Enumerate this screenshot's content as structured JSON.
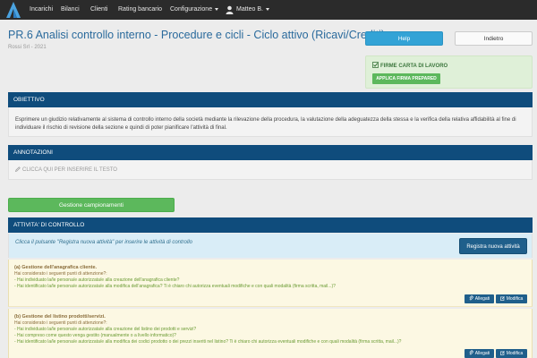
{
  "navbar": {
    "items": [
      "Incarichi",
      "Bilanci",
      "Clienti",
      "Rating bancario",
      "Configurazione"
    ],
    "user": "Matteo B."
  },
  "header": {
    "title": "PR.6 Analisi controllo interno - Procedure e cicli - Ciclo attivo (Ricavi/Crediti)",
    "subtitle": "Rossi Srl - 2021",
    "help_label": "Help",
    "back_label": "Indietro"
  },
  "firme": {
    "title": "FIRME CARTA DI LAVORO",
    "button_label": "APPLICA FIRMA PREPARED"
  },
  "obiettivo": {
    "header": "OBIETTIVO",
    "text": "Esprimere un giudizio relativamente al sistema di controllo interno della società mediante la rilevazione della procedura, la valutazione della adeguatezza della stessa e la verifica della relativa affidabilità al fine di individuare il rischio di revisione della sezione e quindi di poter pianificare l'attività di final."
  },
  "annotazioni": {
    "header": "ANNOTAZIONI",
    "placeholder": "CLICCA QUI PER INSERIRE IL TESTO"
  },
  "gestione_label": "Gestione campionamenti",
  "attivita": {
    "header": "ATTIVITA' DI CONTROLLO",
    "info": "Clicca il pulsante \"Registra nuova attività\" per inserire le attività di controllo",
    "registra_label": "Registra nuova attività",
    "items": [
      {
        "title": "(a) Gestione dell'anagrafica cliente.",
        "lines": [
          "Hai considerato i seguenti punti di attenzione?:",
          "- Hai individuato la/le persona/e autorizzata/e alla creazione dell'anagrafica cliente?",
          "- Hai identificato la/le persona/e autorizzata/e alla modifica dell'anagrafica? Ti è chiaro chi autorizza eventuali modifiche e con quali modalità (firma scritta, mail...)?"
        ],
        "allegati": "Allegati",
        "modifica": "Modifica"
      },
      {
        "title": "(b) Gestione del listino prodotti/servizi.",
        "lines": [
          "Hai considerato i seguenti punti di attenzione?:",
          "- Hai individuato la/le persona/e autorizzata/e alla creazione del listino dei prodotti e servizi?",
          "- Hai compreso come questo venga gestito (manualmente o a livello informatico)?",
          "- Hai identificato la/le persona/e autorizzata/e alla modifica dei codici prodotto o dei prezzi inseriti nel listino? Ti è chiaro chi autorizza eventuali modifiche e con quali modalità (firma scritta, mail...)?"
        ],
        "allegati": "Allegati",
        "modifica": "Modifica"
      }
    ]
  },
  "colors": {
    "navbar": "#2b2b2b",
    "panel_header": "#0f4c7c",
    "title": "#2a6a9c",
    "help": "#33a3d6",
    "success": "#5cb85c",
    "action": "#1f5f8b",
    "info_bg": "#d9edf7",
    "item_bg": "#fcf8e3"
  },
  "icons": [
    "logo-icon",
    "user-icon",
    "check-icon",
    "pencil-icon",
    "paperclip-icon",
    "edit-icon"
  ]
}
